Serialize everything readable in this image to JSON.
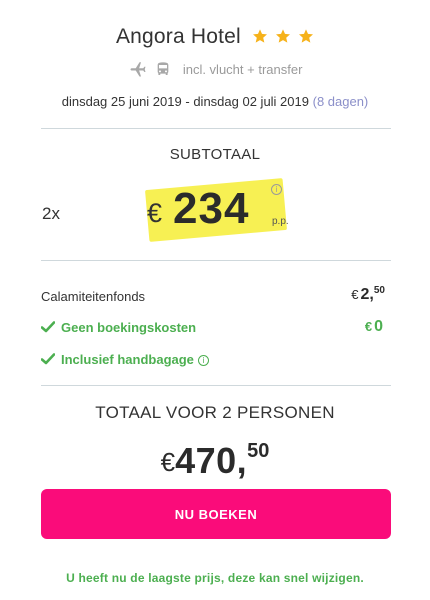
{
  "hotel": {
    "name": "Angora Hotel",
    "star_count": 3,
    "star_color": "#f6b21a"
  },
  "includes": {
    "icons": [
      "plane-icon",
      "bus-icon"
    ],
    "text": "incl. vlucht + transfer"
  },
  "dates": {
    "start": "dinsdag 25 juni 2019",
    "separator": "-",
    "end": "dinsdag 02 juli 2019",
    "duration": "(8 dagen)"
  },
  "subtotal": {
    "label": "SUBTOTAAL",
    "quantity": "2x",
    "currency": "€",
    "price": "234",
    "info_symbol": "i",
    "per_person": "p.p.",
    "highlight_color": "#f7ef4a"
  },
  "fees": {
    "calamity_label": "Calamiteitenfonds",
    "calamity_currency": "€",
    "calamity_whole": "2,",
    "calamity_cents": "50",
    "no_booking_label": "Geen boekingskosten",
    "no_booking_currency": "€",
    "no_booking_value": "0",
    "hand_luggage_label": "Inclusief handbagage",
    "info_symbol": "i"
  },
  "total": {
    "label": "TOTAAL VOOR 2 PERSONEN",
    "currency": "€",
    "whole": "470,",
    "cents": "50"
  },
  "cta": {
    "label": "NU BOEKEN",
    "color": "#fa0c7a"
  },
  "footer": {
    "note": "U heeft nu de laagste prijs, deze kan snel wijzigen."
  },
  "colors": {
    "accent_green": "#4caf50",
    "divider": "#cfd8dc",
    "muted_purple": "#8b8fc9"
  }
}
